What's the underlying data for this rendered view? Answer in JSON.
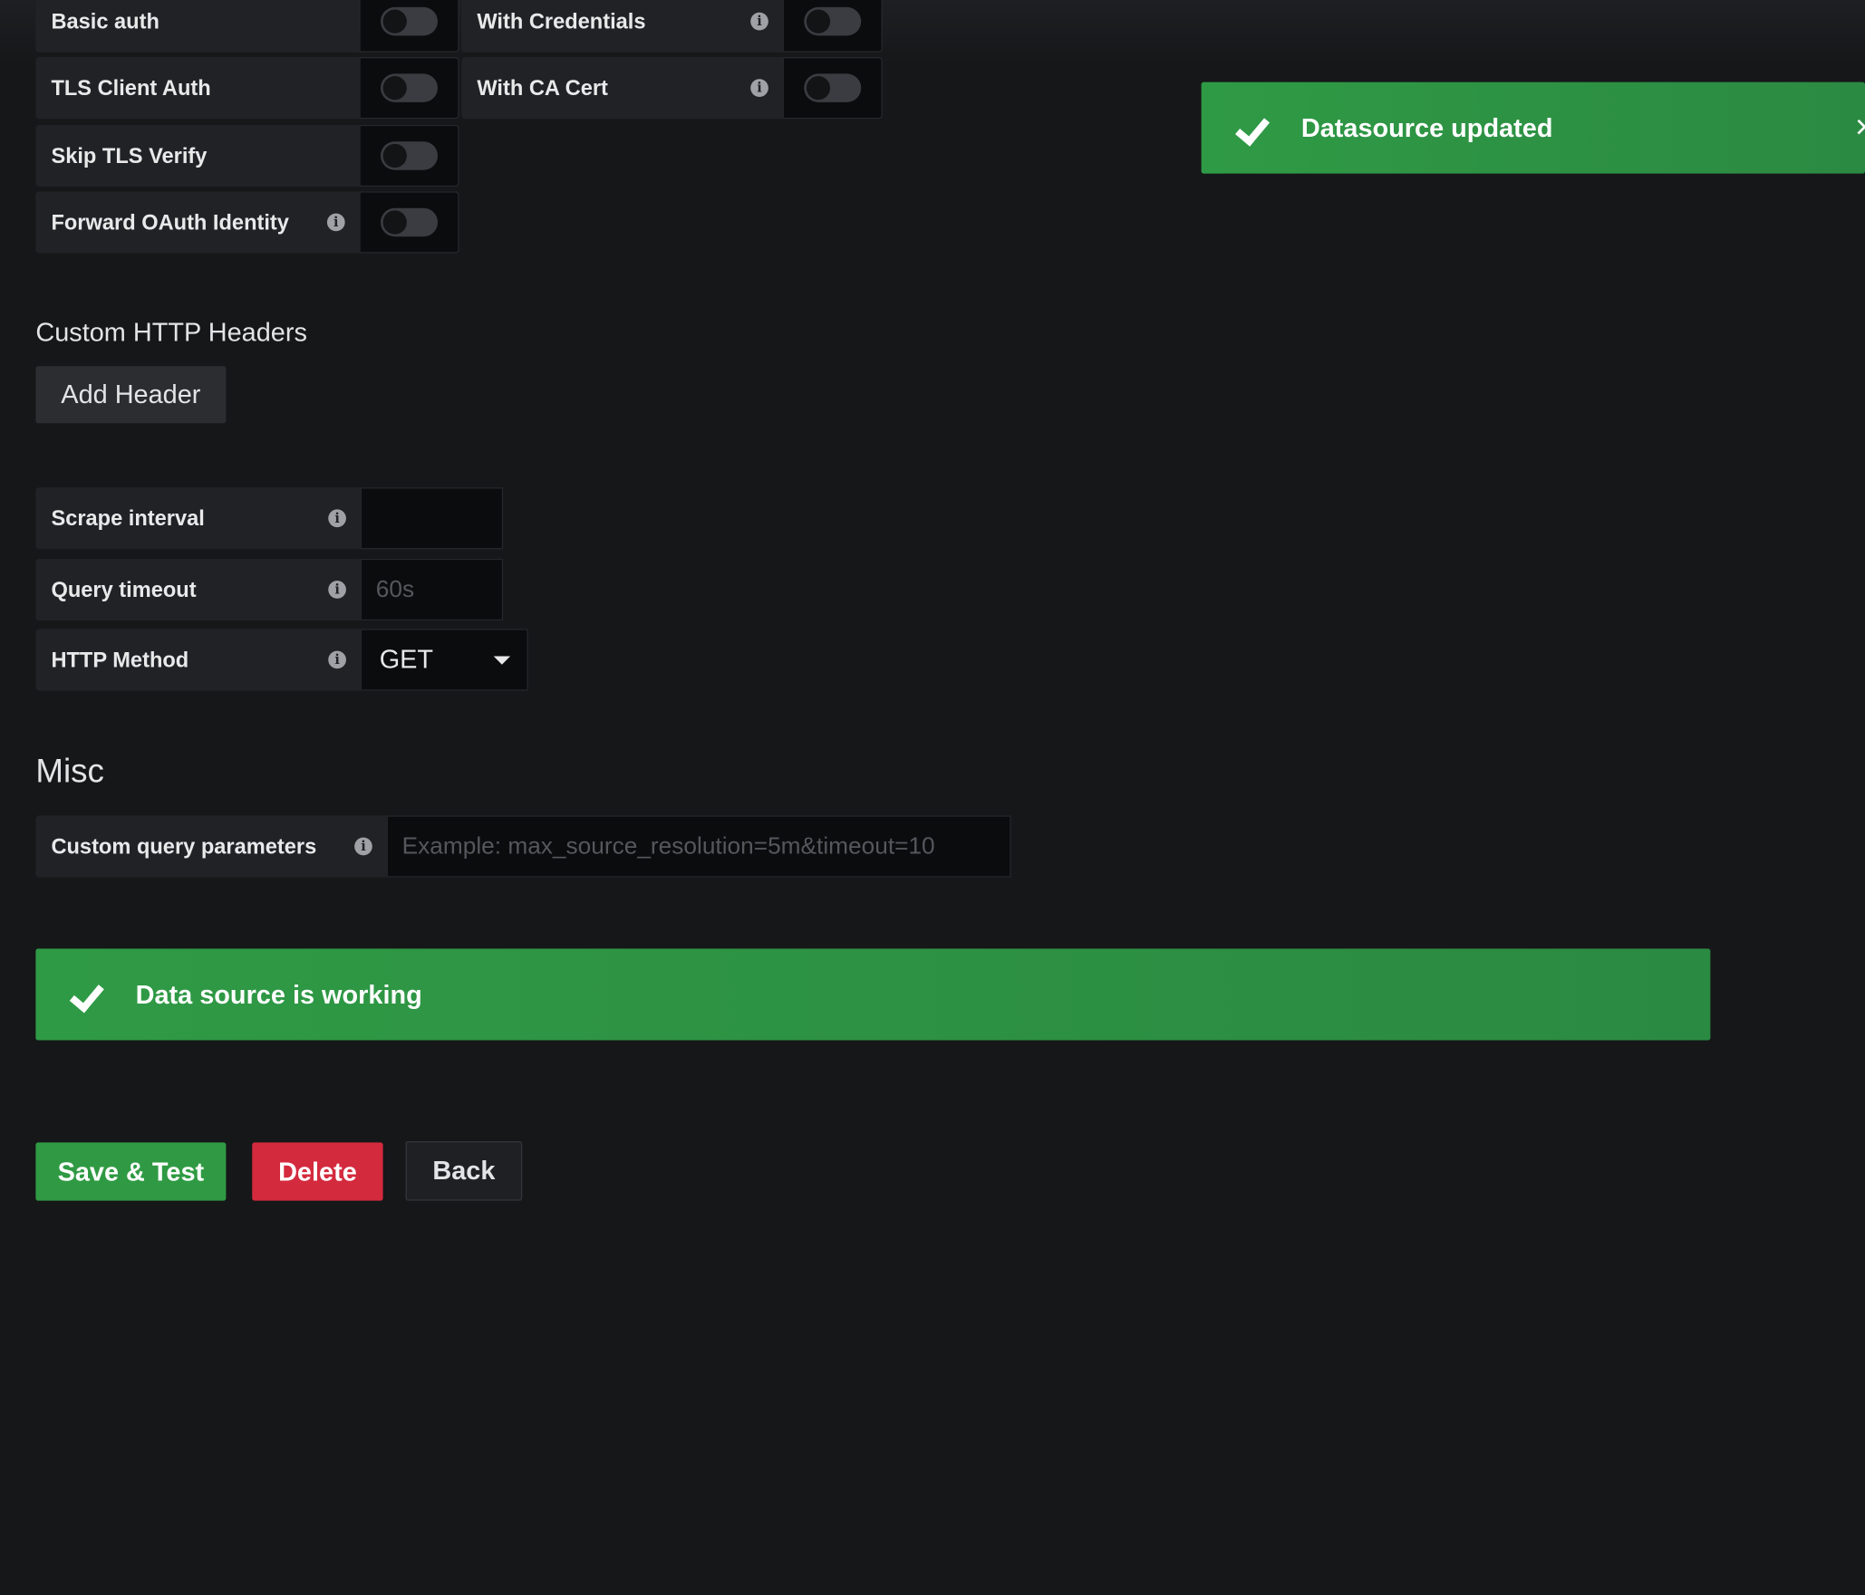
{
  "auth": {
    "basic_auth": "Basic auth",
    "with_credentials": "With Credentials",
    "tls_client_auth": "TLS Client Auth",
    "with_ca_cert": "With CA Cert",
    "skip_tls_verify": "Skip TLS Verify",
    "forward_oauth": "Forward OAuth Identity",
    "info_glyph": "i"
  },
  "headers": {
    "title": "Custom HTTP Headers",
    "add_label": "Add Header"
  },
  "settings": {
    "scrape_interval_label": "Scrape interval",
    "scrape_interval_value": "",
    "query_timeout_label": "Query timeout",
    "query_timeout_placeholder": "60s",
    "http_method_label": "HTTP Method",
    "http_method_value": "GET"
  },
  "misc": {
    "title": "Misc",
    "custom_params_label": "Custom query parameters",
    "custom_params_placeholder": "Example: max_source_resolution=5m&timeout=10"
  },
  "status": {
    "working": "Data source is working",
    "toast": "Datasource updated",
    "toast_close": "×"
  },
  "actions": {
    "save": "Save & Test",
    "delete": "Delete",
    "back": "Back"
  },
  "colors": {
    "background": "#161719",
    "success": "#2f9a43",
    "danger": "#d42a3e"
  }
}
